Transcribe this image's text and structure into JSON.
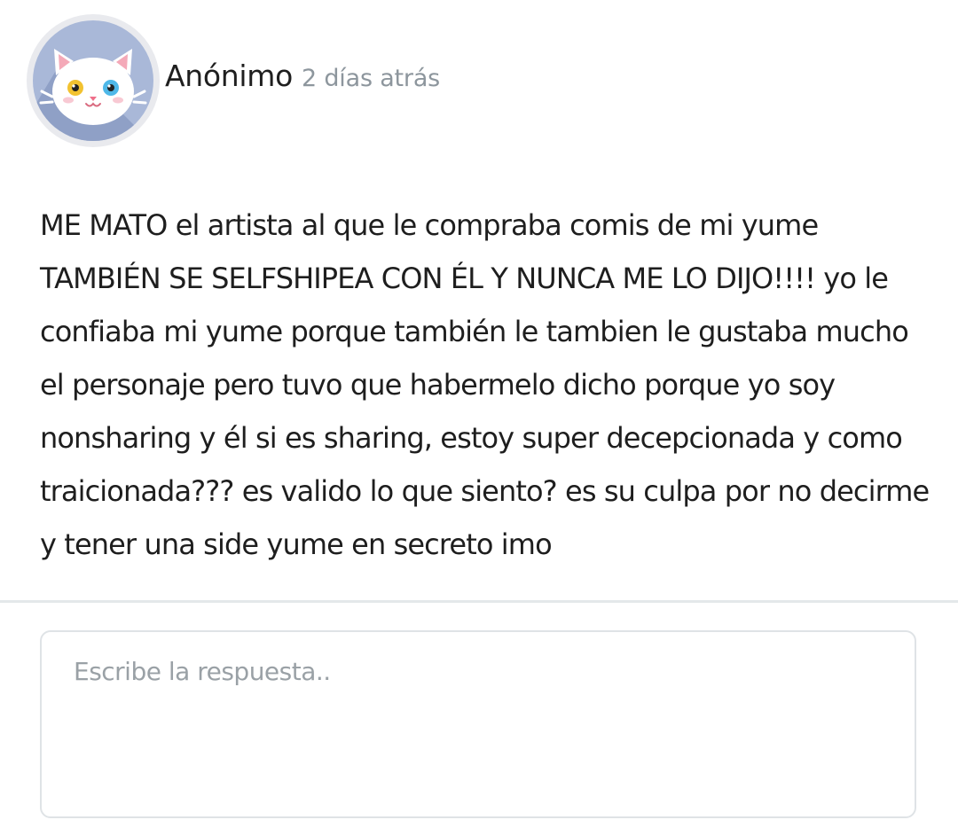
{
  "post": {
    "author": "Anónimo",
    "time": "2 días atrás",
    "avatar_icon": "white-cat-avatar-icon",
    "message": "ME MATO el artista al que le compraba comis de mi yume TAMBIÉN SE SELFSHIPEA CON ÉL Y NUNCA ME LO DIJO!!!! yo le confiaba mi yume porque también le tambien le gustaba mucho el personaje pero tuvo que habermelo dicho porque yo soy nonsharing y él si es sharing, estoy super decepcionada y como traicionada??? es valido lo que siento? es su culpa por no decirme y tener una side yume en secreto imo"
  },
  "reply": {
    "placeholder": "Escribe la respuesta.."
  },
  "colors": {
    "avatar_background": "#a9b8d8",
    "avatar_shadow": "#8fa0c6",
    "divider": "#e4e8ea",
    "muted_text": "#8d969d"
  }
}
